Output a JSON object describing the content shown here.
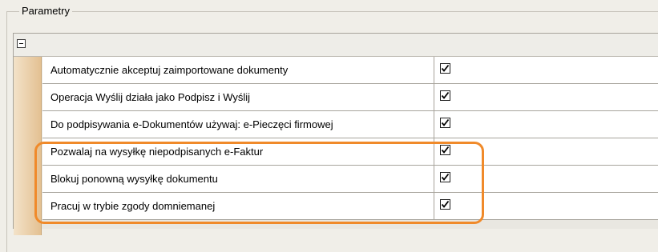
{
  "group": {
    "title": "Parametry"
  },
  "grid": {
    "rows": [
      {
        "label": "Automatycznie akceptuj zaimportowane dokumenty",
        "checked": true
      },
      {
        "label": "Operacja Wyślij działa jako Podpisz i Wyślij",
        "checked": true
      },
      {
        "label": "Do podpisywania e-Dokumentów używaj: e-Pieczęci firmowej",
        "checked": true
      },
      {
        "label": "Pozwalaj na wysyłkę niepodpisanych e-Faktur",
        "checked": true
      },
      {
        "label": "Blokuj ponowną wysyłkę dokumentu",
        "checked": true
      },
      {
        "label": "Pracuj w trybie zgody domniemanej",
        "checked": true
      }
    ]
  },
  "colors": {
    "highlight": "#f08a2a",
    "margin": "#e3c091"
  }
}
